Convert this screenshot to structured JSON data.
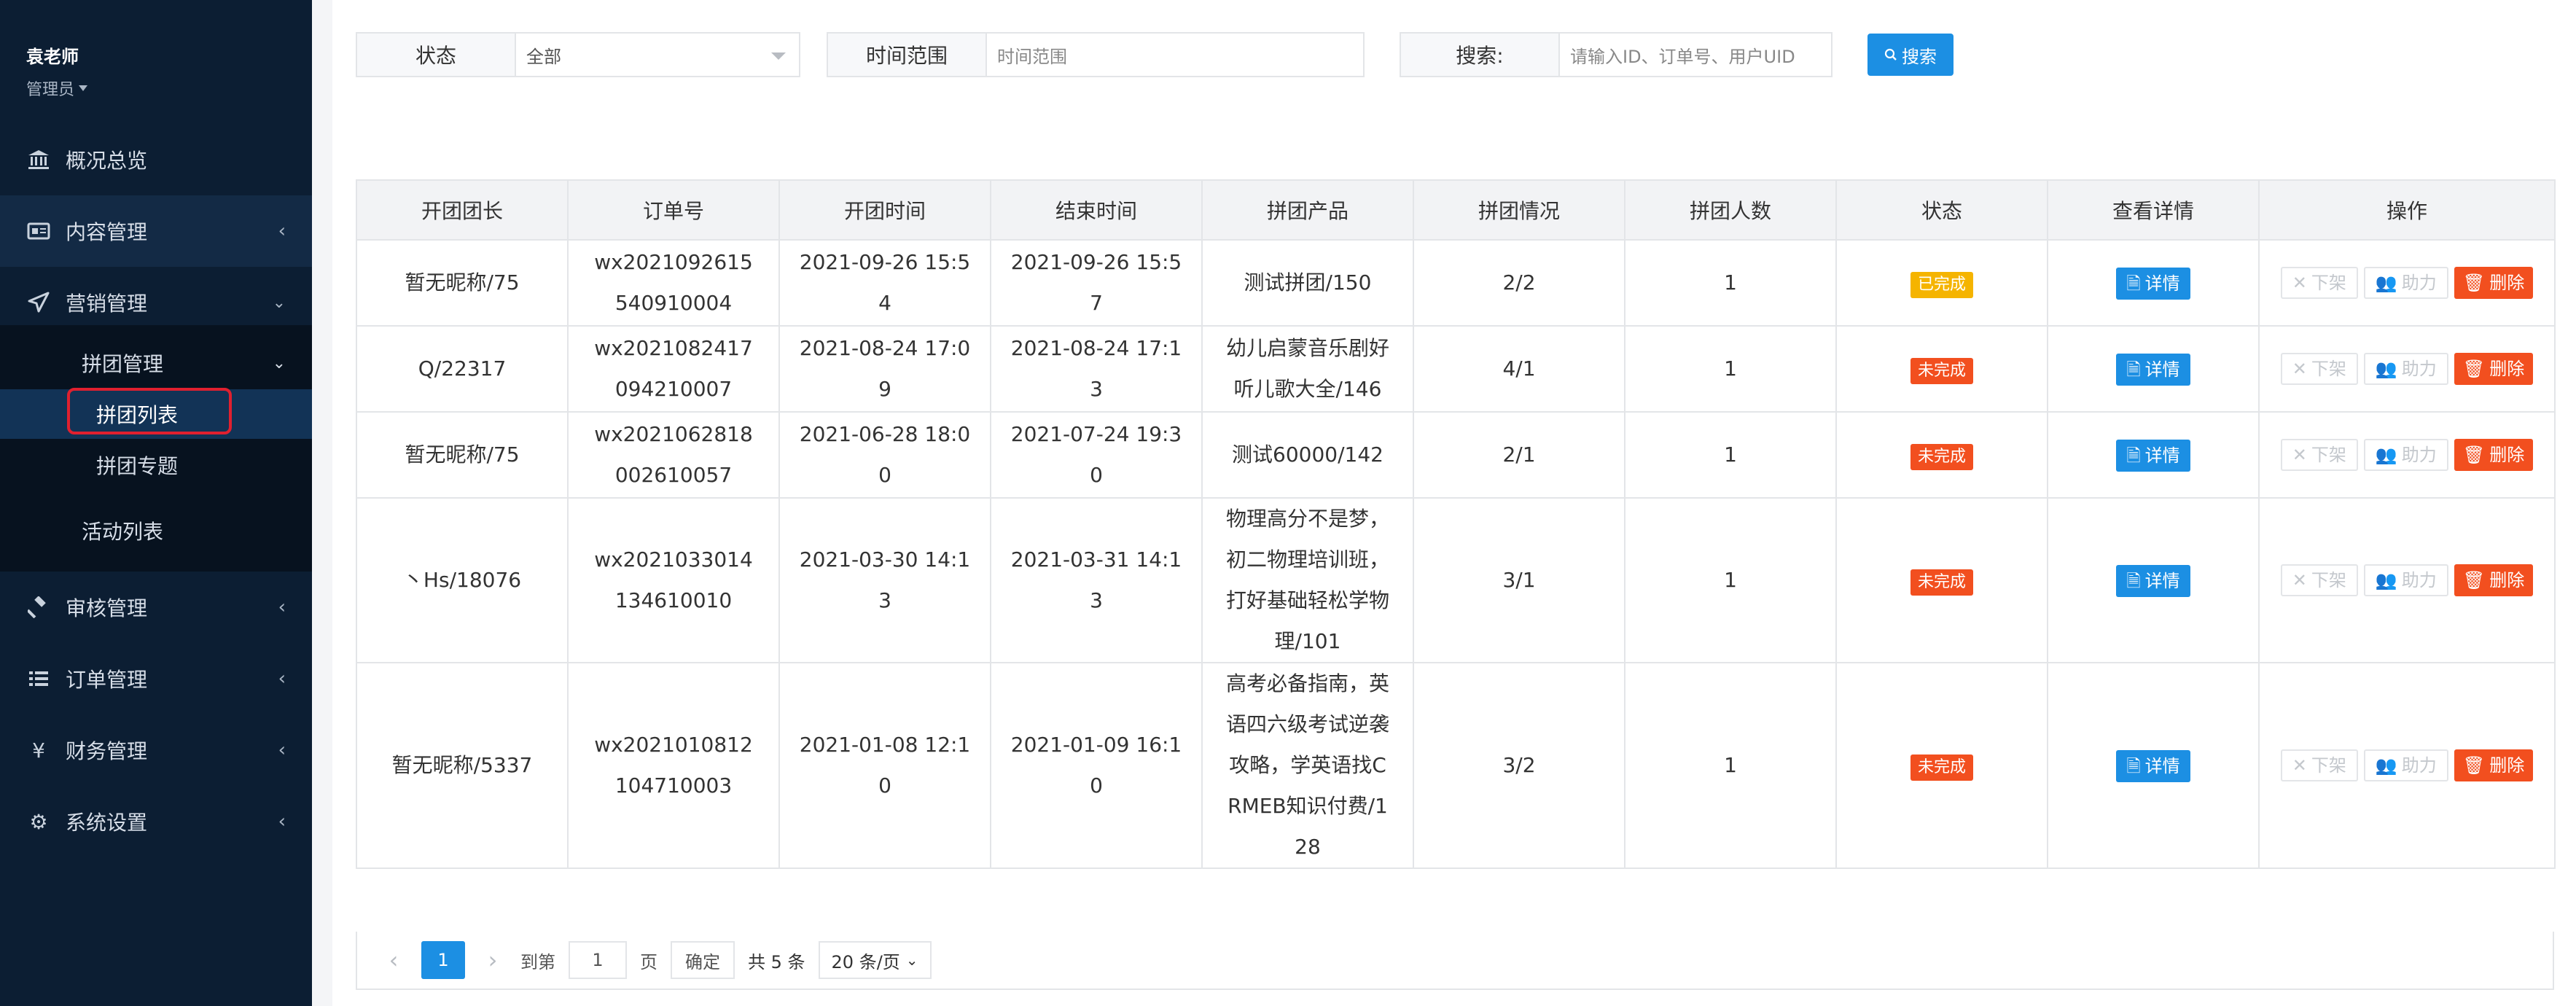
{
  "sidebar": {
    "user_name": "袁老师",
    "user_role": "管理员",
    "items": [
      {
        "label": "概况总览",
        "icon": "bank-icon"
      },
      {
        "label": "内容管理",
        "icon": "content-icon"
      },
      {
        "label": "营销管理",
        "icon": "paper-plane-icon"
      },
      {
        "label": "审核管理",
        "icon": "gavel-icon"
      },
      {
        "label": "订单管理",
        "icon": "list-icon"
      },
      {
        "label": "财务管理",
        "icon": "yen-icon"
      },
      {
        "label": "系统设置",
        "icon": "gear-icon"
      }
    ],
    "sub": {
      "group": "拼团管理",
      "list": "拼团列表",
      "topic": "拼团专题",
      "activity": "活动列表"
    }
  },
  "filters": {
    "status_label": "状态",
    "status_value": "全部",
    "time_label": "时间范围",
    "time_placeholder": "时间范围",
    "search_label": "搜索:",
    "search_placeholder": "请输入ID、订单号、用户UID",
    "search_button": "搜索"
  },
  "table": {
    "headers": [
      "开团团长",
      "订单号",
      "开团时间",
      "结束时间",
      "拼团产品",
      "拼团情况",
      "拼团人数",
      "状态",
      "查看详情",
      "操作"
    ],
    "detail_label": "详情",
    "op_off": "下架",
    "op_assist": "助力",
    "op_delete": "删除",
    "rows": [
      {
        "leader": "暂无昵称/75",
        "order": "wx2021092615540910004",
        "start": "2021-09-26 15:54",
        "end": "2021-09-26 15:57",
        "product": "测试拼团/150",
        "situation": "2/2",
        "count": "1",
        "status": "已完成",
        "status_type": "done"
      },
      {
        "leader": "Q/22317",
        "order": "wx2021082417094210007",
        "start": "2021-08-24 17:09",
        "end": "2021-08-24 17:13",
        "product": "幼儿启蒙音乐剧好听儿歌大全/146",
        "situation": "4/1",
        "count": "1",
        "status": "未完成",
        "status_type": "undone"
      },
      {
        "leader": "暂无昵称/75",
        "order": "wx2021062818002610057",
        "start": "2021-06-28 18:00",
        "end": "2021-07-24 19:30",
        "product": "测试60000/142",
        "situation": "2/1",
        "count": "1",
        "status": "未完成",
        "status_type": "undone"
      },
      {
        "leader": "丶Hs/18076",
        "order": "wx2021033014134610010",
        "start": "2021-03-30 14:13",
        "end": "2021-03-31 14:13",
        "product": "物理高分不是梦，初二物理培训班，打好基础轻松学物理/101",
        "situation": "3/1",
        "count": "1",
        "status": "未完成",
        "status_type": "undone"
      },
      {
        "leader": "暂无昵称/5337",
        "order": "wx2021010812104710003",
        "start": "2021-01-08 12:10",
        "end": "2021-01-09 16:10",
        "product": "高考必备指南，英语四六级考试逆袭攻略，学英语找CRMEB知识付费/128",
        "situation": "3/2",
        "count": "1",
        "status": "未完成",
        "status_type": "undone"
      }
    ]
  },
  "pager": {
    "current": "1",
    "goto_label": "到第",
    "goto_value": "1",
    "page_label": "页",
    "confirm": "确定",
    "total": "共 5 条",
    "page_size": "20 条/页"
  }
}
